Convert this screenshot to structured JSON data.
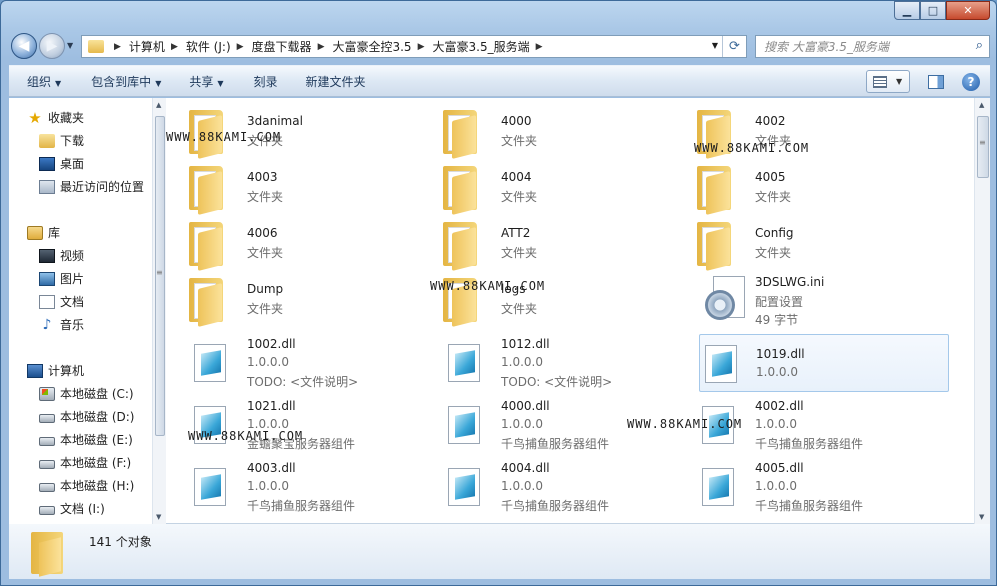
{
  "window": {
    "caption": {
      "minimize": "▁",
      "maximize": "□",
      "close": "✕"
    }
  },
  "nav": {
    "back": "◀",
    "forward": "▶"
  },
  "address": {
    "crumbs": [
      "计算机",
      "软件 (J:)",
      "度盘下载器",
      "大富豪全控3.5",
      "大富豪3.5_服务端"
    ],
    "separator": "▶"
  },
  "search": {
    "placeholder": "搜索 大富豪3.5_服务端"
  },
  "toolbar": {
    "organize": "组织",
    "include_library": "包含到库中",
    "share": "共享",
    "burn": "刻录",
    "new_folder": "新建文件夹"
  },
  "sidebar": {
    "favorites": {
      "label": "收藏夹",
      "items": [
        {
          "label": "下载",
          "icon": "downloads-folder-icon"
        },
        {
          "label": "桌面",
          "icon": "desktop-icon"
        },
        {
          "label": "最近访问的位置",
          "icon": "recent-places-icon"
        }
      ]
    },
    "libraries": {
      "label": "库",
      "items": [
        {
          "label": "视频",
          "icon": "videos-icon"
        },
        {
          "label": "图片",
          "icon": "pictures-icon"
        },
        {
          "label": "文档",
          "icon": "documents-icon"
        },
        {
          "label": "音乐",
          "icon": "music-icon"
        }
      ]
    },
    "computer": {
      "label": "计算机",
      "items": [
        {
          "label": "本地磁盘 (C:)",
          "icon": "system-drive-icon"
        },
        {
          "label": "本地磁盘 (D:)",
          "icon": "drive-icon"
        },
        {
          "label": "本地磁盘 (E:)",
          "icon": "drive-icon"
        },
        {
          "label": "本地磁盘 (F:)",
          "icon": "drive-icon"
        },
        {
          "label": "本地磁盘 (H:)",
          "icon": "drive-icon"
        },
        {
          "label": "文档 (I:)",
          "icon": "drive-icon"
        }
      ]
    }
  },
  "files": [
    {
      "name": "3danimal",
      "line2": "文件夹",
      "line3": "",
      "type": "folder"
    },
    {
      "name": "4000",
      "line2": "文件夹",
      "line3": "",
      "type": "folder"
    },
    {
      "name": "4002",
      "line2": "文件夹",
      "line3": "",
      "type": "folder"
    },
    {
      "name": "4003",
      "line2": "文件夹",
      "line3": "",
      "type": "folder"
    },
    {
      "name": "4004",
      "line2": "文件夹",
      "line3": "",
      "type": "folder"
    },
    {
      "name": "4005",
      "line2": "文件夹",
      "line3": "",
      "type": "folder"
    },
    {
      "name": "4006",
      "line2": "文件夹",
      "line3": "",
      "type": "folder"
    },
    {
      "name": "ATT2",
      "line2": "文件夹",
      "line3": "",
      "type": "folder"
    },
    {
      "name": "Config",
      "line2": "文件夹",
      "line3": "",
      "type": "folder"
    },
    {
      "name": "Dump",
      "line2": "文件夹",
      "line3": "",
      "type": "folder"
    },
    {
      "name": "logs",
      "line2": "文件夹",
      "line3": "",
      "type": "folder"
    },
    {
      "name": "3DSLWG.ini",
      "line2": "配置设置",
      "line3": "49 字节",
      "type": "ini"
    },
    {
      "name": "1002.dll",
      "line2": "1.0.0.0",
      "line3": "TODO: <文件说明>",
      "type": "dll"
    },
    {
      "name": "1012.dll",
      "line2": "1.0.0.0",
      "line3": "TODO: <文件说明>",
      "type": "dll"
    },
    {
      "name": "1019.dll",
      "line2": "1.0.0.0",
      "line3": "",
      "type": "dll",
      "selected": true
    },
    {
      "name": "1021.dll",
      "line2": "1.0.0.0",
      "line3": "金蟾聚宝服务器组件",
      "type": "dll"
    },
    {
      "name": "4000.dll",
      "line2": "1.0.0.0",
      "line3": "千鸟捕鱼服务器组件",
      "type": "dll"
    },
    {
      "name": "4002.dll",
      "line2": "1.0.0.0",
      "line3": "千鸟捕鱼服务器组件",
      "type": "dll"
    },
    {
      "name": "4003.dll",
      "line2": "1.0.0.0",
      "line3": "千鸟捕鱼服务器组件",
      "type": "dll"
    },
    {
      "name": "4004.dll",
      "line2": "1.0.0.0",
      "line3": "千鸟捕鱼服务器组件",
      "type": "dll"
    },
    {
      "name": "4005.dll",
      "line2": "1.0.0.0",
      "line3": "千鸟捕鱼服务器组件",
      "type": "dll"
    }
  ],
  "watermark": "WWW.88KAMI.COM",
  "status": {
    "count": "141 个对象"
  }
}
